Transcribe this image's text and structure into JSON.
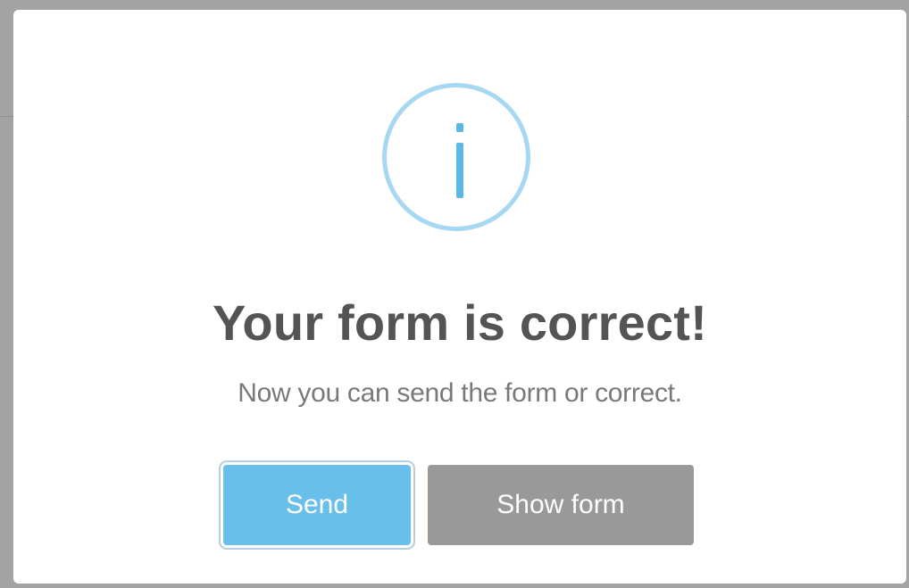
{
  "dialog": {
    "icon": "info-icon",
    "title": "Your form is correct!",
    "message": "Now you can send the form or correct.",
    "buttons": {
      "send_label": "Send",
      "show_form_label": "Show form"
    }
  },
  "colors": {
    "icon_ring": "#a6d8f1",
    "icon_glyph": "#5cb8e6",
    "title": "#545454",
    "message": "#797979",
    "confirm_button": "#68bfe9",
    "cancel_button": "#999999",
    "overlay": "#a3a3a3"
  }
}
